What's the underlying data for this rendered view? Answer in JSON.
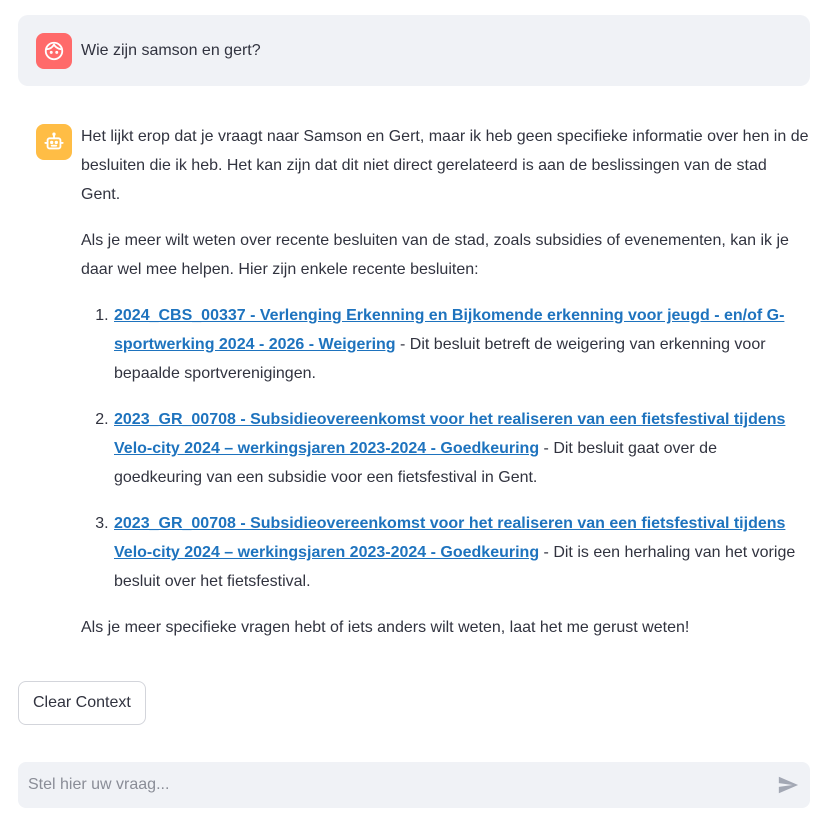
{
  "colors": {
    "user_avatar_bg": "#ff6a6a",
    "bot_avatar_bg": "#ffbd45",
    "link": "#1e73be",
    "message_bg": "#f0f2f6"
  },
  "user_message": {
    "avatar_icon": "user-face-icon",
    "text": "Wie zijn samson en gert?"
  },
  "bot_message": {
    "avatar_icon": "robot-icon",
    "intro": "Het lijkt erop dat je vraagt naar Samson en Gert, maar ik heb geen specifieke informatie over hen in de besluiten die ik heb. Het kan zijn dat dit niet direct gerelateerd is aan de beslissingen van de stad Gent.",
    "lead": "Als je meer wilt weten over recente besluiten van de stad, zoals subsidies of evenementen, kan ik je daar wel mee helpen. Hier zijn enkele recente besluiten:",
    "items": [
      {
        "link": "2024_CBS_00337 - Verlenging Erkenning en Bijkomende erkenning voor jeugd - en/of G-sportwerking 2024 - 2026 - Weigering",
        "desc": " - Dit besluit betreft de weigering van erkenning voor bepaalde sportverenigingen."
      },
      {
        "link": "2023_GR_00708 - Subsidieovereenkomst voor het realiseren van een fietsfestival tijdens Velo-city 2024 – werkingsjaren 2023-2024 - Goedkeuring",
        "desc": " - Dit besluit gaat over de goedkeuring van een subsidie voor een fietsfestival in Gent."
      },
      {
        "link": "2023_GR_00708 - Subsidieovereenkomst voor het realiseren van een fietsfestival tijdens Velo-city 2024 – werkingsjaren 2023-2024 - Goedkeuring",
        "desc": " - Dit is een herhaling van het vorige besluit over het fietsfestival."
      }
    ],
    "closing": "Als je meer specifieke vragen hebt of iets anders wilt weten, laat het me gerust weten!"
  },
  "clear_button": {
    "label": "Clear Context"
  },
  "chat_input": {
    "placeholder": "Stel hier uw vraag...",
    "value": "",
    "send_icon": "send-icon"
  }
}
